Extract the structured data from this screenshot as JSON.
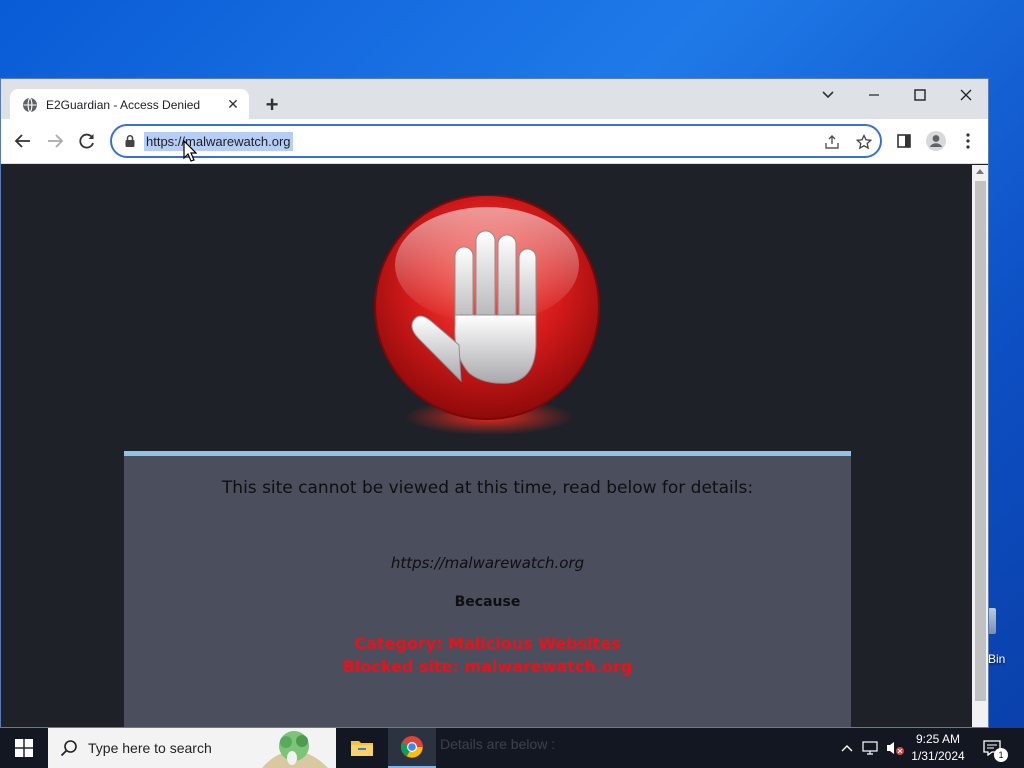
{
  "colors": {
    "accent": "#3a6fd8",
    "panel_bg": "#4b4e5c",
    "page_bg": "#1f2128",
    "alert_red": "#e8121a",
    "stop_red": "#d41a1a"
  },
  "desktop": {
    "recycle_bin_label": "Bin"
  },
  "browser": {
    "tab": {
      "title": "E2Guardian - Access Denied",
      "favicon": "globe-icon"
    },
    "address_bar": {
      "url": "https://malwarewatch.org",
      "selected": true
    },
    "icons": [
      "back-icon",
      "forward-icon",
      "reload-icon",
      "lock-icon",
      "share-icon",
      "star-icon",
      "side-panel-icon",
      "profile-icon",
      "menu-icon"
    ]
  },
  "page": {
    "heading": "This site cannot be viewed at this time, read below for details:",
    "blocked_url": "https://malwarewatch.org",
    "because_label": "Because",
    "category": "Category: Malicious Websites",
    "blocked_site": "Blocked site: malwarewatch.org"
  },
  "taskbar": {
    "search_placeholder": "Type here to search",
    "behind_text": "Details are below :",
    "clock": {
      "time": "9:25 AM",
      "date": "1/31/2024"
    },
    "notification_count": "1"
  }
}
